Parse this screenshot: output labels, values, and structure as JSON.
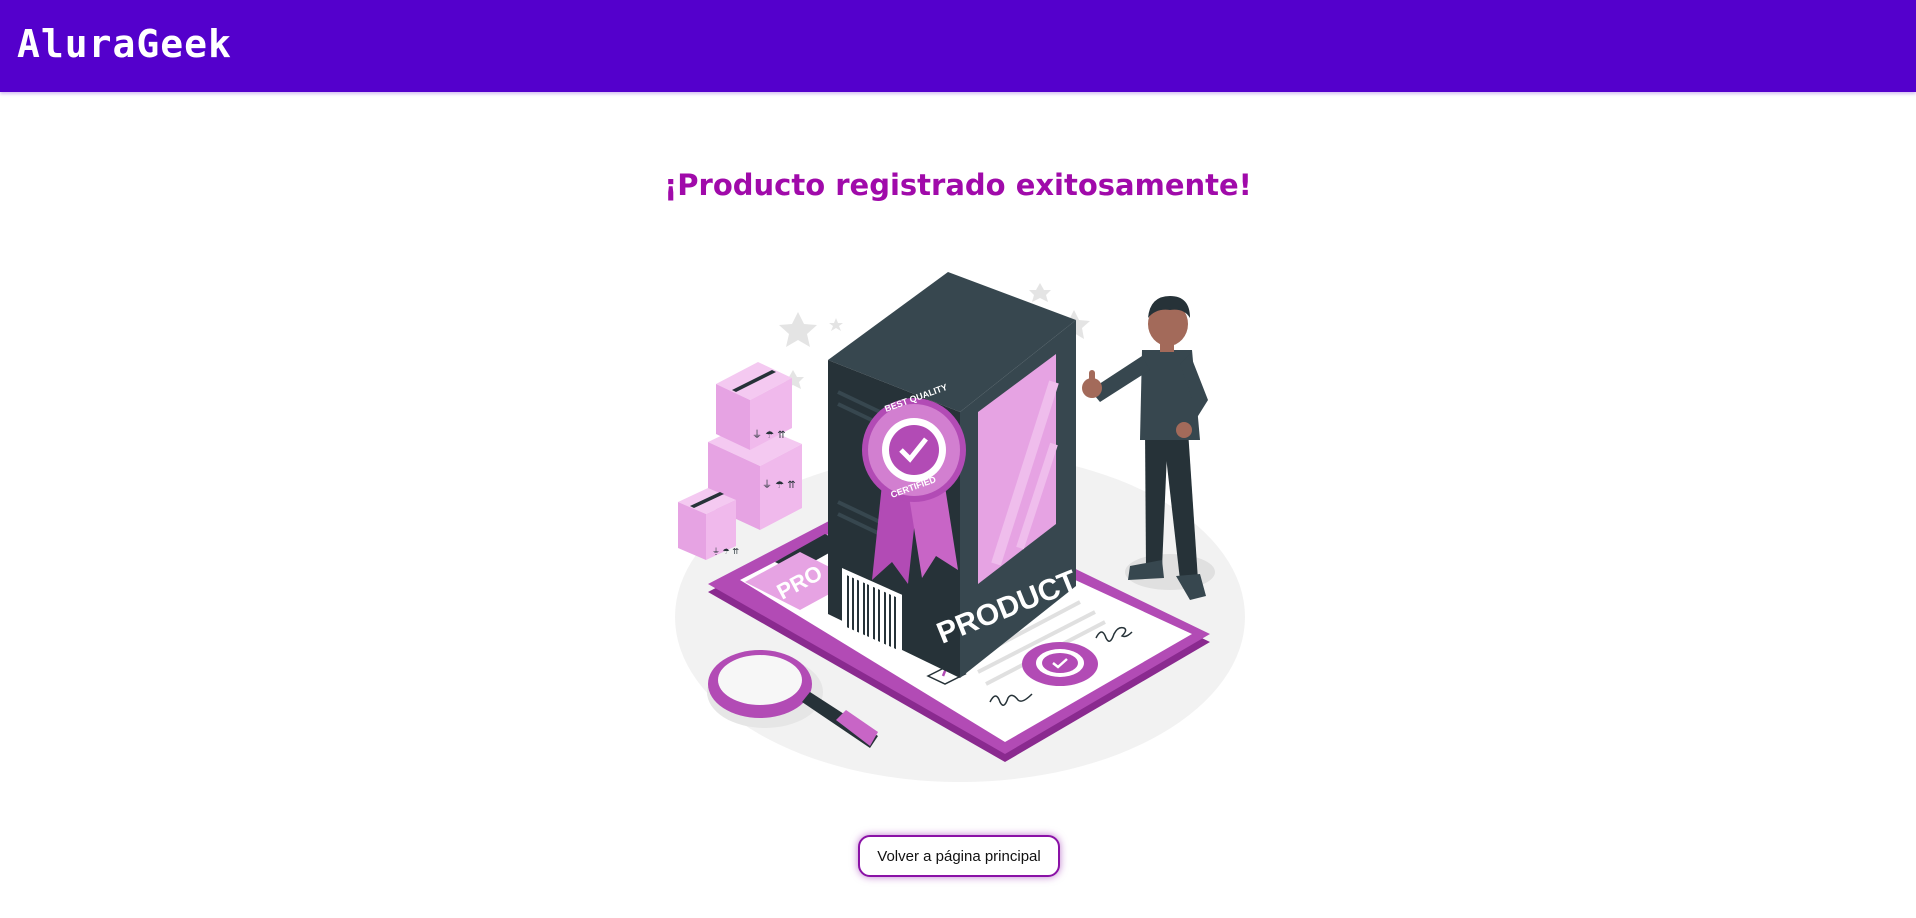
{
  "header": {
    "logo_text": "AluraGeek"
  },
  "main": {
    "title": "¡Producto registrado exitosamente!",
    "illustration": {
      "box_label": "PRODUCT",
      "clipboard_label": "PRO",
      "seal_top_text": "BEST QUALITY",
      "seal_bottom_text": "CERTIFIED"
    },
    "back_button_label": "Volver a página principal"
  },
  "colors": {
    "header_bg": "#5400cc",
    "title": "#a00aaa",
    "accent_pink": "#e6a3e3",
    "accent_purple": "#8a12a6",
    "box_dark": "#263238"
  }
}
